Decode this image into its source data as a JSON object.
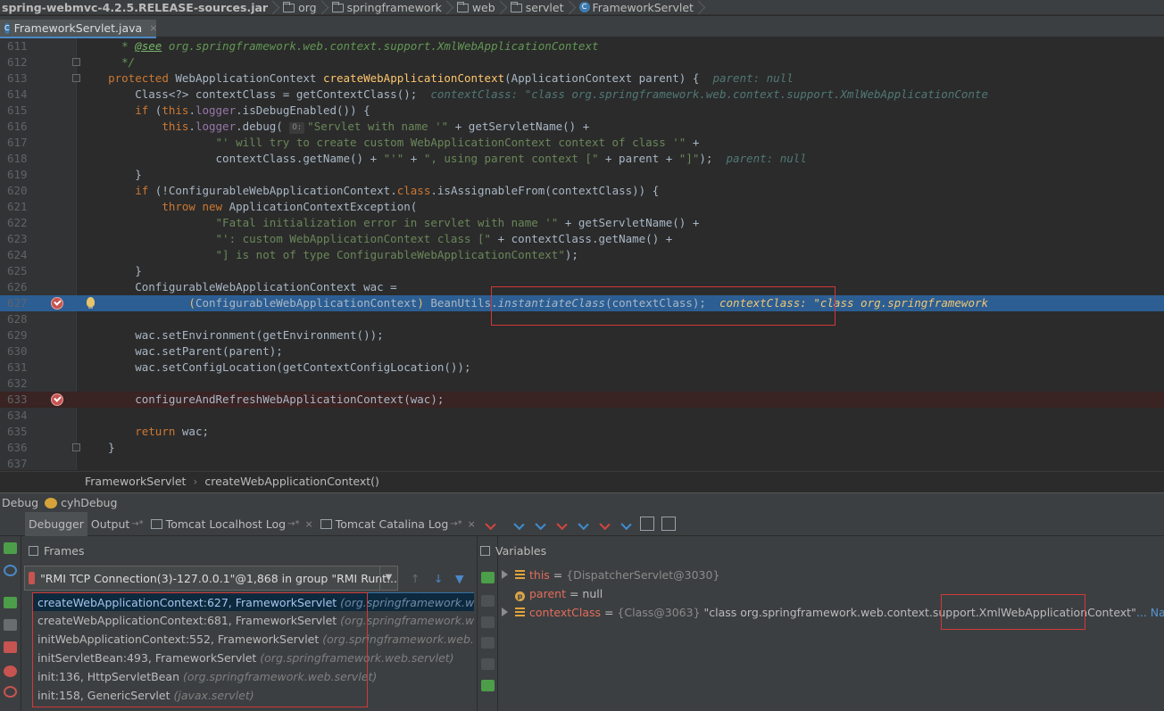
{
  "navbar": {
    "items": [
      {
        "label": "spring-webmvc-4.2.5.RELEASE-sources.jar",
        "icon": "jar-icon"
      },
      {
        "label": "org",
        "icon": "folder-icon"
      },
      {
        "label": "springframework",
        "icon": "folder-icon"
      },
      {
        "label": "web",
        "icon": "folder-icon"
      },
      {
        "label": "servlet",
        "icon": "folder-icon"
      },
      {
        "label": "FrameworkServlet",
        "icon": "class-icon"
      }
    ]
  },
  "tab": {
    "label": "FrameworkServlet.java",
    "close": "×",
    "icon": "class-icon"
  },
  "editor": {
    "lines": [
      "611",
      "612",
      "613",
      "614",
      "615",
      "616",
      "617",
      "618",
      "619",
      "620",
      "621",
      "622",
      "623",
      "624",
      "625",
      "626",
      "627",
      "628",
      "629",
      "630",
      "631",
      "632",
      "633",
      "634",
      "635",
      "636",
      "637"
    ],
    "hint_label": "O:",
    "inline": {
      "parent_null": "parent: null",
      "context_class_614": "contextClass: \"class org.springframework.web.context.support.XmlWebApplicationConte",
      "parent_null_618": "parent: null",
      "context_class_627": "contextClass: \"class org.springframework"
    }
  },
  "code": {
    "l611_see": "@see",
    "l611_rest": " org.springframework.web.context.support.XmlWebApplicationContext",
    "l612": "*/"
  },
  "editor_breadcrumb": {
    "class": "FrameworkServlet",
    "method": "createWebApplicationContext()",
    "arrow": "›"
  },
  "debug": {
    "title": "Debug",
    "config": "cyhDebug",
    "tabs": [
      {
        "label": "Debugger",
        "active": true
      },
      {
        "label": "Output",
        "suffix": "→*"
      },
      {
        "label": "Tomcat Localhost Log",
        "suffix": "→*"
      },
      {
        "label": "Tomcat Catalina Log",
        "suffix": "→*"
      }
    ],
    "frames_title": "Frames",
    "variables_title": "Variables",
    "thread": "\"RMI TCP Connection(3)-127.0.0.1\"@1,868 in group \"RMI Runt...",
    "frames": [
      {
        "method": "createWebApplicationContext:627, FrameworkServlet",
        "pkg": "(org.springframework.web.ser",
        "selected": true
      },
      {
        "method": "createWebApplicationContext:681, FrameworkServlet",
        "pkg": "(org.springframework.web.ser"
      },
      {
        "method": "initWebApplicationContext:552, FrameworkServlet",
        "pkg": "(org.springframework.web.servlet"
      },
      {
        "method": "initServletBean:493, FrameworkServlet",
        "pkg": "(org.springframework.web.servlet)"
      },
      {
        "method": "init:136, HttpServletBean",
        "pkg": "(org.springframework.web.servlet)"
      },
      {
        "method": "init:158, GenericServlet",
        "pkg": "(javax.servlet)"
      }
    ],
    "variables": [
      {
        "name": "this",
        "eq": " = ",
        "value": "{DispatcherServlet@3030}"
      },
      {
        "name": "parent",
        "eq": " = ",
        "value": "null"
      },
      {
        "name": "contextClass",
        "eq": " = ",
        "obj": "{Class@3063}",
        "value": " \"class org.springframework.web.context.support.XmlWebApplicationContext\"",
        "link": "... Navigate"
      }
    ]
  },
  "colors": {
    "accent": "#4a88c7",
    "highlight": "#d0393a",
    "selection": "#2c5e93"
  }
}
